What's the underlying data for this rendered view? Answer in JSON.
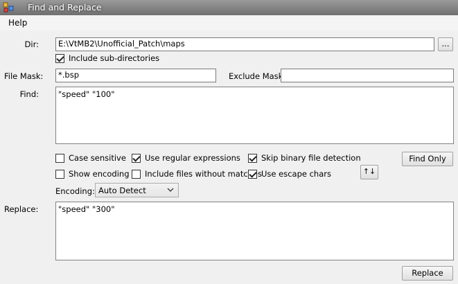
{
  "window": {
    "title": "Find and Replace"
  },
  "menu": {
    "help": "Help"
  },
  "dir": {
    "label": "Dir:",
    "value": "E:\\VtMB2\\Unofficial_Patch\\maps",
    "browse_label": "..."
  },
  "include_subdirs": {
    "label": "Include sub-directories",
    "checked": true
  },
  "file_mask": {
    "label": "File Mask:",
    "value": "*.bsp"
  },
  "exclude_mask": {
    "label": "Exclude Mask:",
    "value": ""
  },
  "find": {
    "label": "Find:",
    "value": "\"speed\" \"100\""
  },
  "options": {
    "case_sensitive": {
      "label": "Case sensitive",
      "checked": false
    },
    "use_regex": {
      "label": "Use regular expressions",
      "checked": true
    },
    "skip_binary": {
      "label": "Skip binary file detection",
      "checked": true
    },
    "show_encoding": {
      "label": "Show encoding",
      "checked": false
    },
    "include_no_match": {
      "label": "Include files without matches",
      "checked": false
    },
    "escape_chars": {
      "label": "Use escape chars",
      "checked": true
    }
  },
  "find_only_label": "Find Only",
  "swap_label": "↑↓",
  "encoding": {
    "label": "Encoding:",
    "value": "Auto Detect"
  },
  "replace": {
    "label": "Replace:",
    "value": "\"speed\" \"300\""
  },
  "replace_button_label": "Replace"
}
